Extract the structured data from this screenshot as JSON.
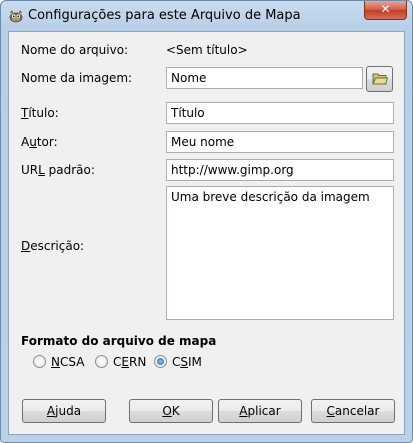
{
  "window": {
    "title": "Configurações para este Arquivo de Mapa",
    "close_symbol": "✕",
    "app_icon": "gimp-icon"
  },
  "form": {
    "filename": {
      "label": "Nome do arquivo:",
      "value": "<Sem título>"
    },
    "image_name": {
      "label": "Nome da imagem:",
      "value": "Nome",
      "browse_icon": "folder-open-icon"
    },
    "title": {
      "label_pre": "",
      "label_ul": "T",
      "label_post": "ítulo:",
      "value": "Título"
    },
    "author": {
      "label_pre": "A",
      "label_ul": "u",
      "label_post": "tor:",
      "value": "Meu nome"
    },
    "default_url": {
      "label_pre": "UR",
      "label_ul": "L",
      "label_post": " padrão:",
      "value": "http://www.gimp.org"
    },
    "description": {
      "label_pre": "",
      "label_ul": "D",
      "label_post": "escrição:",
      "value": "Uma breve descrição da imagem"
    }
  },
  "map_format": {
    "title": "Formato do arquivo de mapa",
    "options": [
      {
        "pre": "",
        "ul": "N",
        "post": "CSA",
        "checked": false
      },
      {
        "pre": "C",
        "ul": "E",
        "post": "RN",
        "checked": false
      },
      {
        "pre": "C",
        "ul": "S",
        "post": "IM",
        "checked": true
      }
    ]
  },
  "buttons": {
    "help": {
      "pre": "",
      "ul": "A",
      "post": "juda"
    },
    "ok": {
      "pre": "",
      "ul": "O",
      "post": "K"
    },
    "apply": {
      "pre": "",
      "ul": "A",
      "post": "plicar"
    },
    "cancel": {
      "pre": "",
      "ul": "C",
      "post": "ancelar"
    }
  }
}
